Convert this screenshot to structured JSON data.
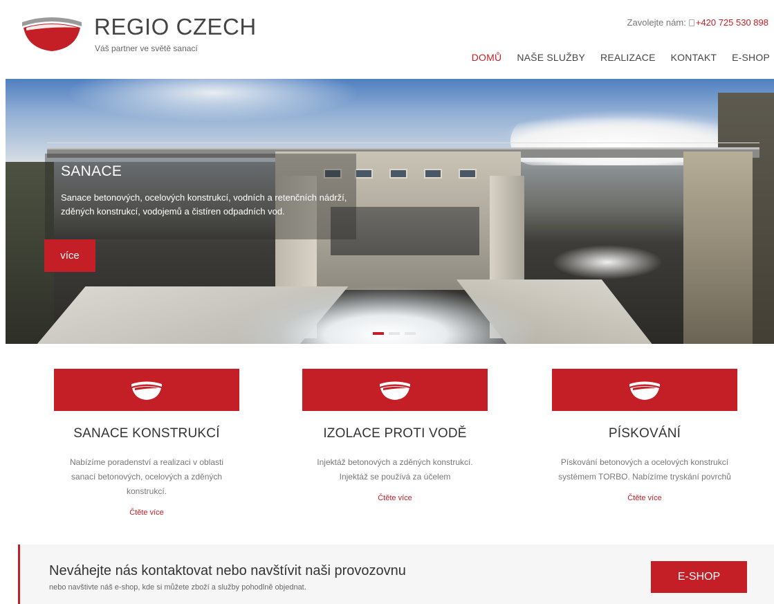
{
  "header": {
    "brand_title": "REGIO CZECH",
    "tagline": "Váš partner ve světě sanací",
    "call_label": "Zavolejte nám:",
    "phone": "+420 725 530 898",
    "phone_icon": "phone-icon"
  },
  "nav": {
    "items": [
      {
        "label": "DOMŮ",
        "active": true
      },
      {
        "label": "NAŠE SLUŽBY",
        "active": false
      },
      {
        "label": "REALIZACE",
        "active": false
      },
      {
        "label": "KONTAKT",
        "active": false
      },
      {
        "label": "E-SHOP",
        "active": false
      }
    ]
  },
  "hero": {
    "title": "SANACE",
    "text": "Sanace betonových, ocelových konstrukcí, vodních a retenčních nádrží, zděných konstrukcí, vodojemů a čistíren odpadních vod.",
    "button": "více",
    "slides": 3,
    "active_slide": 1
  },
  "services": [
    {
      "title": "SANACE KONSTRUKCÍ",
      "text": "Nabízíme poradenství a realizaci v oblasti sanací betonových, ocelových a zděných konstrukcí.",
      "link": "Čtěte více",
      "icon": "logo-mark-icon"
    },
    {
      "title": "IZOLACE PROTI VODĚ",
      "text": "Injektáž betonových a zděných konstrukcí. Injektáž se používá za účelem",
      "link": "Čtěte více",
      "icon": "logo-mark-icon"
    },
    {
      "title": "PÍSKOVÁNÍ",
      "text": "Pískování betonových a ocelových konstrukcí systémem TORBO. Nabízíme tryskání povrchů",
      "link": "Čtěte více",
      "icon": "logo-mark-icon"
    }
  ],
  "cta": {
    "title": "Neváhejte nás kontaktovat nebo navštívit naši provozovnu",
    "subtitle": "nebo navštivte náš e-shop, kde si můžete zboží a služby pohodlně objednat.",
    "button": "E-SHOP"
  },
  "colors": {
    "accent": "#c41e26",
    "text": "#333333",
    "muted": "#777777",
    "cta_bg": "#f6f6f6"
  }
}
